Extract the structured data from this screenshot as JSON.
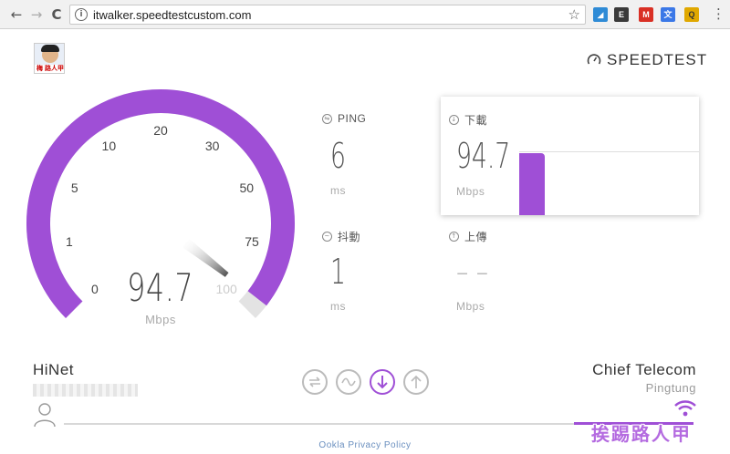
{
  "browser": {
    "url": "itwalker.speedtestcustom.com",
    "back_glyph": "←",
    "forward_glyph": "→",
    "reload_glyph": "C",
    "info_glyph": "i",
    "star_glyph": "☆",
    "menu_glyph": "⋮",
    "extensions": [
      {
        "icon": "pocket-icon",
        "color": "#2f8bd6"
      },
      {
        "icon": "evernote-icon",
        "color": "#3a3a3a"
      },
      {
        "icon": "gmail-icon",
        "color": "#d93025"
      },
      {
        "icon": "translate-icon",
        "color": "#3b78e7"
      },
      {
        "icon": "q-icon",
        "color": "#e0a800"
      }
    ]
  },
  "header": {
    "avatar_caption": "梅 路人甲",
    "brand": "SPEEDTEST"
  },
  "gauge": {
    "value": "94.7",
    "unit": "Mbps",
    "ticks": [
      "0",
      "1",
      "5",
      "10",
      "20",
      "30",
      "50",
      "75",
      "100"
    ],
    "level_mbps": 94.7,
    "accent": "#9f4fd6"
  },
  "metrics": {
    "ping": {
      "label": "PING",
      "value": "6",
      "unit": "ms"
    },
    "jitter": {
      "label": "抖動",
      "value": "1",
      "unit": "ms"
    },
    "download": {
      "label": "下載",
      "value": "94.7",
      "unit": "Mbps"
    },
    "upload": {
      "label": "上傳",
      "value": "– –",
      "unit": "Mbps"
    }
  },
  "isp": {
    "name": "HiNet"
  },
  "server": {
    "name": "Chief Telecom",
    "city": "Pingtung"
  },
  "footer": {
    "privacy": "Ookla Privacy Policy",
    "watermark": "挨踢路人甲"
  },
  "steps": [
    {
      "icon": "ping-step-icon",
      "active": false
    },
    {
      "icon": "jitter-step-icon",
      "active": false
    },
    {
      "icon": "download-step-icon",
      "active": true
    },
    {
      "icon": "upload-step-icon",
      "active": false
    }
  ],
  "progress": 0.19
}
